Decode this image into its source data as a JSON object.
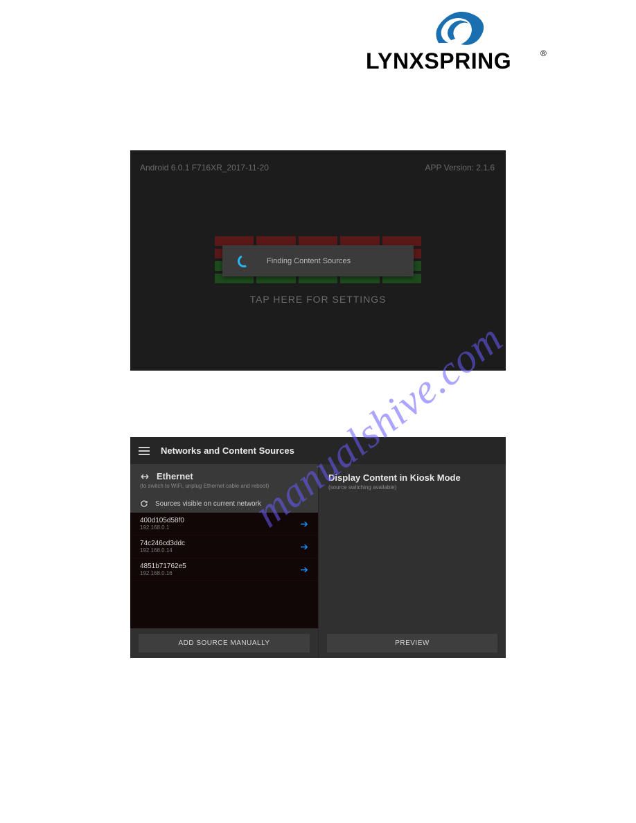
{
  "logo": {
    "brand_text": "LYNXSPRING",
    "registered": "®"
  },
  "screenshot1": {
    "android_info": "Android 6.0.1 F716XR_2017-11-20",
    "app_version": "APP Version: 2.1.6",
    "toast_text": "Finding Content Sources",
    "tap_text": "TAP HERE FOR SETTINGS"
  },
  "screenshot2": {
    "header_title": "Networks and Content Sources",
    "ethernet_label": "Ethernet",
    "ethernet_note": "(to switch to WiFi, unplug Ethernet cable and reboot)",
    "refresh_label": "Sources visible on current network",
    "sources": [
      {
        "name": "400d105d58f0",
        "ip": "192.168.0.1"
      },
      {
        "name": "74c246cd3ddc",
        "ip": "192.168.0.14"
      },
      {
        "name": "4851b71762e5",
        "ip": "192.168.0.16"
      }
    ],
    "add_button": "ADD SOURCE MANUALLY",
    "right_title": "Display Content in Kiosk Mode",
    "right_subtitle": "(source switching available)",
    "preview_button": "PREVIEW"
  },
  "watermark": "manualshive.com"
}
